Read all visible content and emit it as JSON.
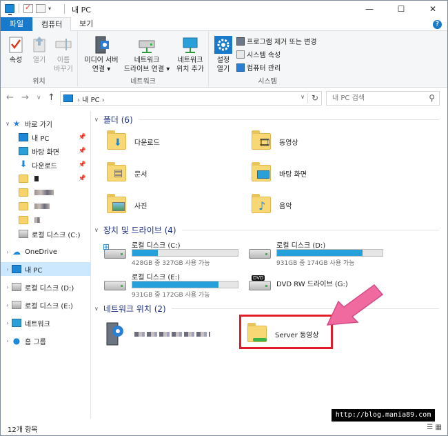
{
  "window": {
    "title": "내 PC",
    "controls": {
      "minimize": "—",
      "maximize": "☐",
      "close": "✕"
    }
  },
  "ribbon_tabs": [
    {
      "label": "파일"
    },
    {
      "label": "컴퓨터"
    },
    {
      "label": "보기"
    }
  ],
  "ribbon": {
    "groups": {
      "location": {
        "label": "위치",
        "buttons": [
          "속성",
          "열기",
          "이름",
          "바꾸기"
        ]
      },
      "network": {
        "label": "네트워크",
        "buttons": [
          {
            "line1": "미디어 서버",
            "line2": "연결 ▾"
          },
          {
            "line1": "네트워크",
            "line2": "드라이브 연결 ▾"
          },
          {
            "line1": "네트워크",
            "line2": "위치 추가"
          }
        ]
      },
      "system": {
        "label": "시스템",
        "settings": {
          "line1": "설정",
          "line2": "열기"
        },
        "small": [
          "프로그램 제거 또는 변경",
          "시스템 속성",
          "컴퓨터 관리"
        ]
      }
    }
  },
  "address": {
    "crumb": "내 PC",
    "search_placeholder": "내 PC 검색"
  },
  "navpane": {
    "quick_access": "바로 가기",
    "items": [
      {
        "label": "내 PC",
        "pinned": true
      },
      {
        "label": "바탕 화면",
        "pinned": true
      },
      {
        "label": "다운로드",
        "pinned": true
      },
      {
        "label": "",
        "pinned": true
      },
      {
        "label": "",
        "pinned": false
      },
      {
        "label": "",
        "pinned": false
      },
      {
        "label": "",
        "pinned": false
      },
      {
        "label": "로컬 디스크 (C:)",
        "pinned": false
      }
    ],
    "onedrive": "OneDrive",
    "this_pc": "내 PC",
    "disk_d": "로컬 디스크 (D:)",
    "disk_e": "로컬 디스크 (E:)",
    "network": "네트워크",
    "homegroup": "홈 그룹"
  },
  "sections": {
    "folders": {
      "title": "폴더 (6)",
      "items": [
        "다운로드",
        "동영상",
        "문서",
        "바탕 화면",
        "사진",
        "음악"
      ]
    },
    "drives": {
      "title": "장치 및 드라이브 (4)",
      "items": [
        {
          "name": "로컬 디스크 (C:)",
          "free": "428GB 중 327GB 사용 가능",
          "used_fraction": 0.24
        },
        {
          "name": "로컬 디스크 (D:)",
          "free": "931GB 중 174GB 사용 가능",
          "used_fraction": 0.81
        },
        {
          "name": "로컬 디스크 (E:)",
          "free": "931GB 중 172GB 사용 가능",
          "used_fraction": 0.82
        },
        {
          "name": "DVD RW 드라이브 (G:)",
          "free": "",
          "used_fraction": null
        }
      ]
    },
    "network": {
      "title": "네트워크 위치 (2)",
      "items": [
        "",
        "Server 동영상"
      ]
    }
  },
  "status": {
    "count": "12개 항목"
  },
  "watermark": "http://blog.mania89.com",
  "colors": {
    "accent": "#1979ca",
    "highlight": "#e21b2a",
    "arrow": "#f06aa0",
    "bar": "#26a0da"
  }
}
